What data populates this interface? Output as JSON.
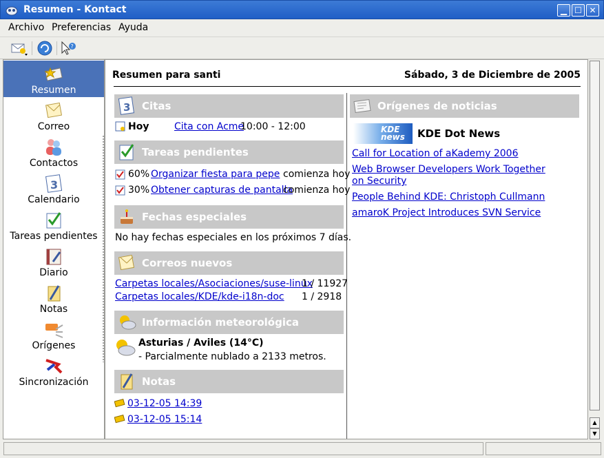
{
  "window": {
    "title": "Resumen - Kontact",
    "min_label": "▁",
    "max_label": "☐",
    "close_label": "✕"
  },
  "menu": {
    "items": [
      "Archivo",
      "Preferencias",
      "Ayuda"
    ]
  },
  "sidebar": {
    "items": [
      {
        "label": "Resumen",
        "icon": "summary-icon",
        "selected": true
      },
      {
        "label": "Correo",
        "icon": "mail-icon"
      },
      {
        "label": "Contactos",
        "icon": "contacts-icon"
      },
      {
        "label": "Calendario",
        "icon": "calendar-icon"
      },
      {
        "label": "Tareas pendientes",
        "icon": "todo-icon"
      },
      {
        "label": "Diario",
        "icon": "journal-icon"
      },
      {
        "label": "Notas",
        "icon": "notes-icon"
      },
      {
        "label": "Orígenes",
        "icon": "rss-icon"
      },
      {
        "label": "Sincronización",
        "icon": "sync-icon"
      }
    ]
  },
  "summary": {
    "title": "Resumen para santi",
    "date": "Sábado, 3 de Diciembre de 2005",
    "appointments": {
      "heading": "Citas",
      "day": "Hoy",
      "event": "Cita con Acme",
      "time": "10:00 - 12:00"
    },
    "todos": {
      "heading": "Tareas pendientes",
      "items": [
        {
          "percent": "60%",
          "title": "Organizar fiesta para pepe",
          "status": "comienza hoy"
        },
        {
          "percent": "30%",
          "title": "Obtener capturas de pantalla",
          "status": "comienza hoy"
        }
      ]
    },
    "special_dates": {
      "heading": "Fechas especiales",
      "text": "No hay fechas especiales en los próximos 7 días."
    },
    "new_mail": {
      "heading": "Correos nuevos",
      "folders": [
        {
          "path": "Carpetas locales/Asociaciones/suse-linux",
          "count": "1 / 11927"
        },
        {
          "path": "Carpetas locales/KDE/kde-i18n-doc",
          "count": "1 / 2918"
        }
      ]
    },
    "weather": {
      "heading": "Información meteorológica",
      "station": "Asturias / Aviles (14°C)",
      "detail": "- Parcialmente nublado a 2133 metros."
    },
    "notes": {
      "heading": "Notas",
      "items": [
        "03-12-05 14:39",
        "03-12-05 15:14"
      ]
    },
    "news": {
      "heading": "Orígenes de noticias",
      "logo_text": "KDE news",
      "source": "KDE Dot News",
      "items": [
        "Call for Location of aKademy 2006",
        "Web Browser Developers Work Together on Security",
        "People Behind KDE: Christoph Cullmann",
        "amaroK Project Introduces SVN Service"
      ]
    }
  }
}
